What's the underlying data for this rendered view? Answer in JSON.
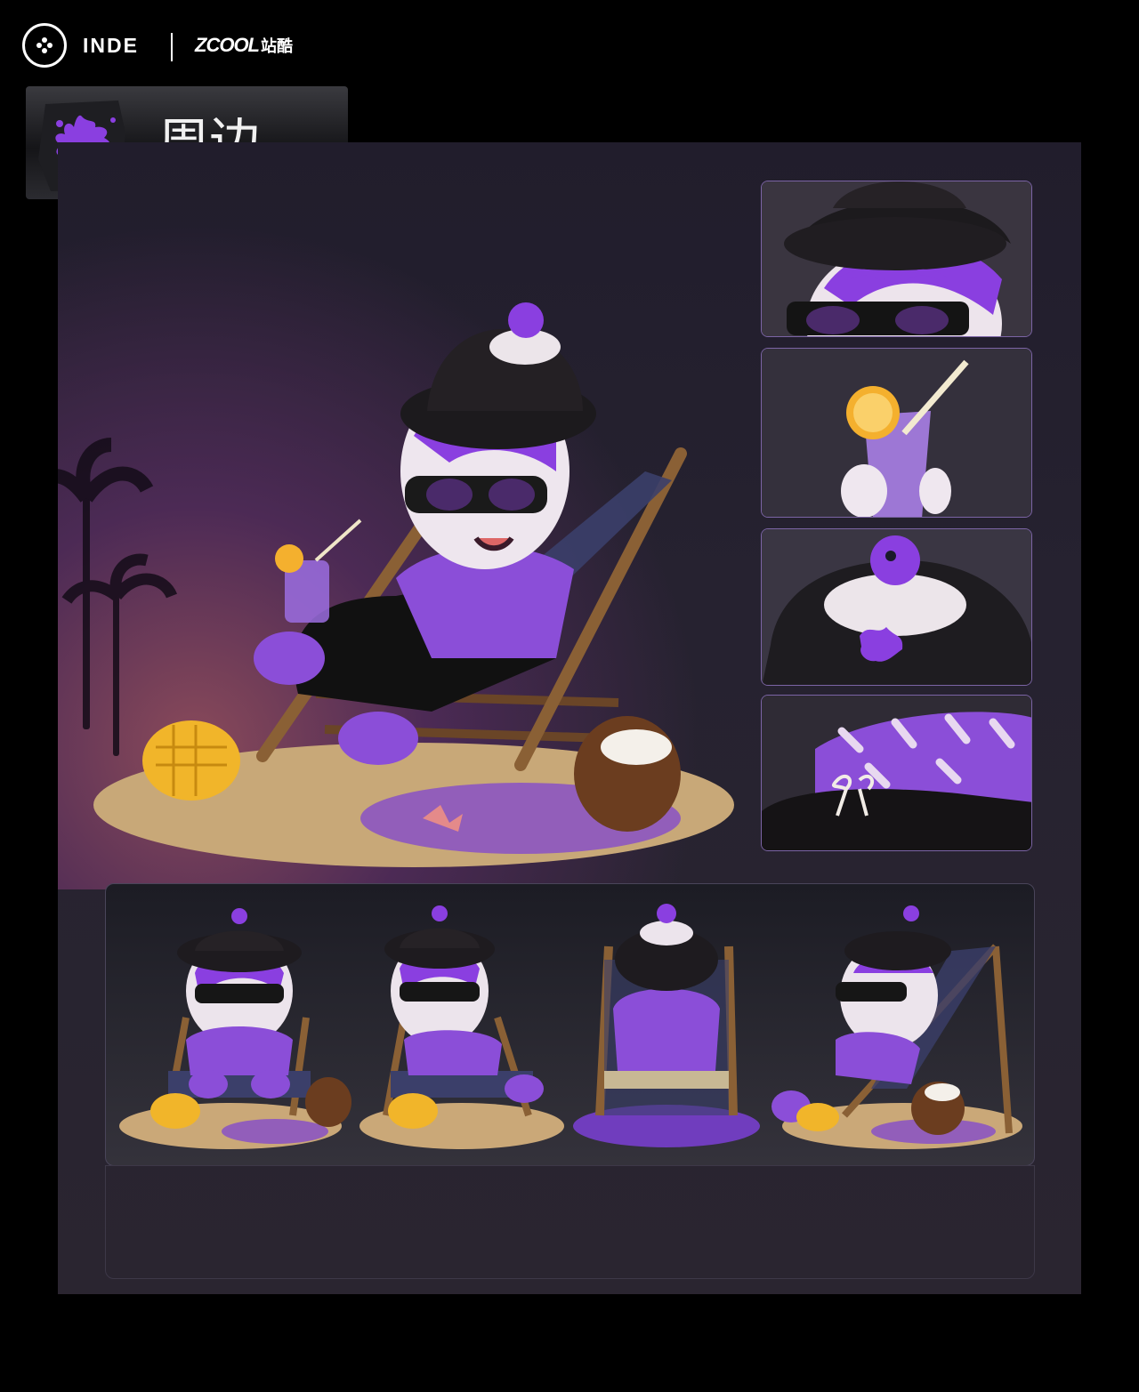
{
  "header": {
    "brand_primary": "INDE",
    "brand_secondary": "ZCOOL",
    "brand_secondary_cn": "站酷"
  },
  "section": {
    "title": "周边"
  },
  "colors": {
    "accent_purple": "#7b3fd6",
    "thumb_border": "#7b64a5",
    "background": "#000000",
    "panel": "#252130"
  },
  "icons": {
    "logo": "four-dot-circle-logo",
    "section": "purple-splat-icon"
  },
  "gallery": {
    "hero": "mascot-on-beach-chair",
    "details": [
      "hat-sunglasses-closeup",
      "drink-closeup",
      "hat-top-closeup",
      "shirt-shorts-closeup"
    ],
    "views": [
      "front-view",
      "three-quarter-view",
      "back-view",
      "side-view"
    ]
  }
}
